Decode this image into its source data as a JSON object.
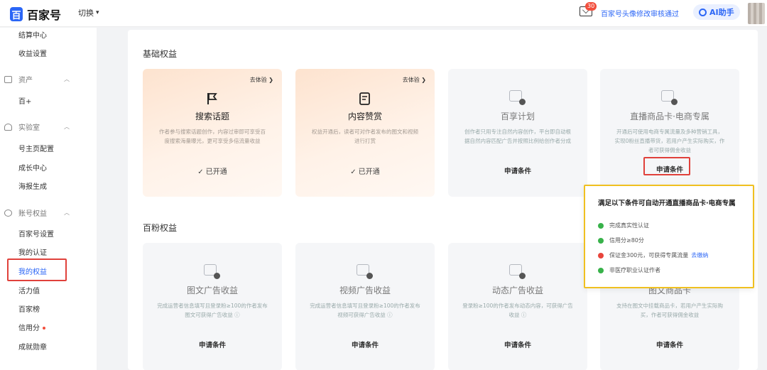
{
  "header": {
    "logo_mark": "百",
    "logo_text": "百家号",
    "switch_label": "切换",
    "mail_badge": "30",
    "notice": "百家号头像修改审核通过",
    "ai_label": "AI助手"
  },
  "sidebar": {
    "items": [
      {
        "label": "结算中心"
      },
      {
        "label": "收益设置"
      },
      {
        "label": "资产",
        "group": true
      },
      {
        "label": "百+"
      },
      {
        "label": "实验室",
        "group": true
      },
      {
        "label": "号主页配置"
      },
      {
        "label": "成长中心"
      },
      {
        "label": "海报生成"
      },
      {
        "label": "账号权益",
        "group": true
      },
      {
        "label": "百家号设置"
      },
      {
        "label": "我的认证"
      },
      {
        "label": "我的权益"
      },
      {
        "label": "活力值"
      },
      {
        "label": "百家榜"
      },
      {
        "label": "信用分"
      },
      {
        "label": "成就勋章"
      }
    ]
  },
  "basic": {
    "section_title": "基础权益",
    "cards": [
      {
        "try": "去体验 ❯",
        "title": "搜索话题",
        "desc": "作者参与搜索话题创作，内容过审即可享受百度搜索海量曝光，更可享受多倍流量收益",
        "status": "✓ 已开通"
      },
      {
        "try": "去体验 ❯",
        "title": "内容赞赏",
        "desc": "权益开通后，读者可对作者发布的图文和视频进行打赏",
        "status": "✓ 已开通"
      },
      {
        "title": "百享计划",
        "desc": "创作者只用专注自然内容创作，平台即自动根据自然内容匹配广告并按照比例给创作者分成",
        "apply": "申请条件"
      },
      {
        "title": "直播商品卡·电商专属",
        "desc": "开通后可使用电商专属流量及多种营销工具，实现0粉丝直播带货，若用户产生实际购买，作者可获得佣金收益",
        "apply": "申请条件"
      }
    ]
  },
  "fans": {
    "section_title": "百粉权益",
    "cards": [
      {
        "title": "图文广告收益",
        "desc": "完成运营者信息填写且登录粉≥100的作者发布图文可获得广告收益 ⓘ",
        "apply": "申请条件"
      },
      {
        "title": "视频广告收益",
        "desc": "完成运营者信息填写且登录粉≥100的作者发布视频可获得广告收益 ⓘ",
        "apply": "申请条件"
      },
      {
        "title": "动态广告收益",
        "desc": "登录粉≥100的作者发布动态内容，可获得广告收益 ⓘ",
        "apply": "申请条件"
      },
      {
        "title": "图文商品卡",
        "desc": "支持在图文中挂载商品卡，若用户产生实际购买，作者可获得佣金收益",
        "apply": "申请条件"
      }
    ]
  },
  "popover": {
    "title": "满足以下条件可自动开通直播商品卡·电商专属",
    "conditions": [
      {
        "text": "完成真实性认证",
        "color": "#38b24a"
      },
      {
        "text": "信用分≥80分",
        "color": "#38b24a"
      },
      {
        "text": "保证金300元，可获得专属流量",
        "link": "去缴纳",
        "color": "#e8453c"
      },
      {
        "text": "非医疗职业认证作者",
        "color": "#38b24a"
      }
    ]
  },
  "colors": {
    "brand": "#2b66f6",
    "highlight_red": "#e0413b",
    "popover_border": "#f0c020",
    "ok_green": "#38b24a"
  }
}
